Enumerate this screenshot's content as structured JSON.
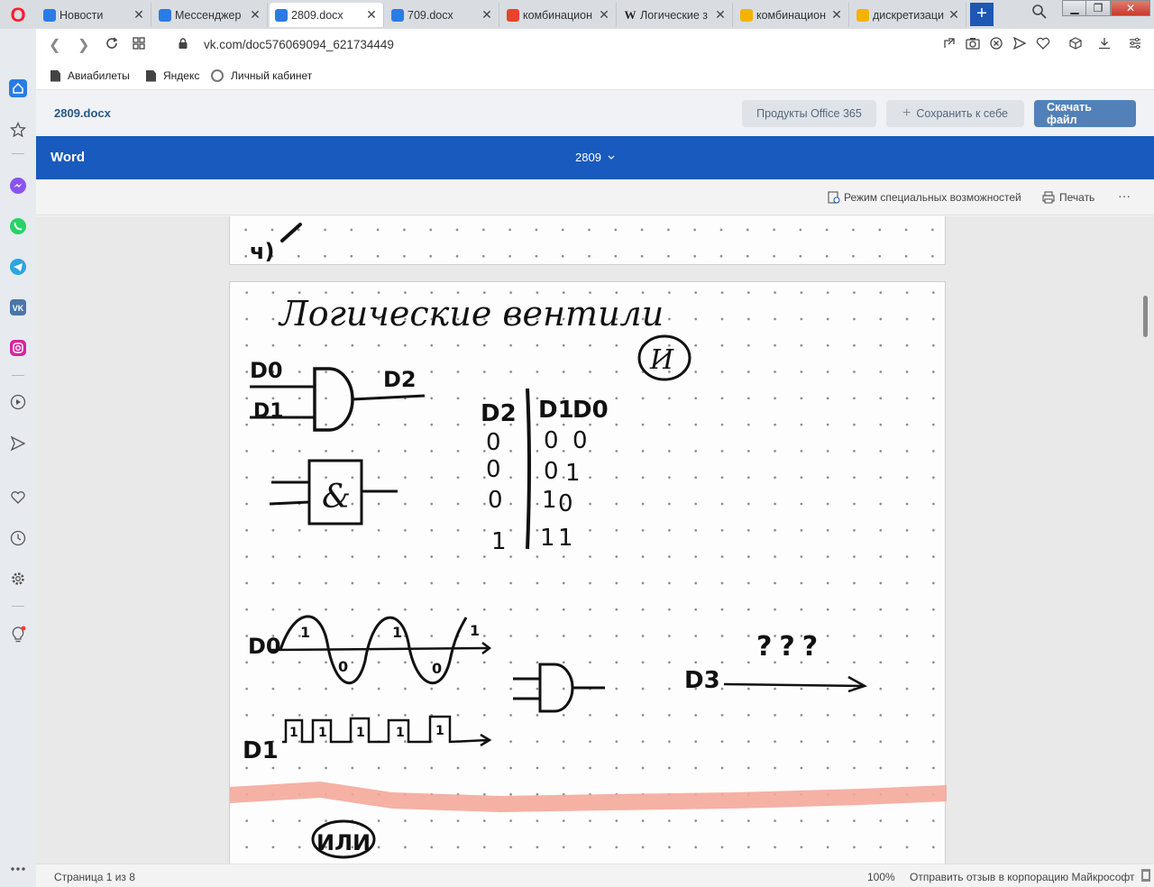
{
  "tabs": [
    {
      "title": "Новости",
      "icon": "vk-messenger-icon",
      "color": "#2a7be4"
    },
    {
      "title": "Мессенджер",
      "icon": "vk-messenger-icon",
      "color": "#2a7be4"
    },
    {
      "title": "2809.docx",
      "icon": "vk-icon",
      "color": "#2a7be4",
      "active": true
    },
    {
      "title": "709.docx",
      "icon": "vk-icon",
      "color": "#2a7be4"
    },
    {
      "title": "комбинацион",
      "icon": "yandex-icon",
      "color": "#e8432c"
    },
    {
      "title": "Логические з",
      "icon": "wikipedia-icon",
      "color": "#222222"
    },
    {
      "title": "комбинацион",
      "icon": "image-icon",
      "color": "#f2b400"
    },
    {
      "title": "дискретизаци",
      "icon": "image-icon",
      "color": "#f2b400"
    }
  ],
  "browser": {
    "logo": "O",
    "new_tab": "+",
    "url": "vk.com/doc576069094_621734449"
  },
  "bookmarks": [
    {
      "label": "Авиабилеты",
      "icon": "bookmark-icon"
    },
    {
      "label": "Яндекс",
      "icon": "bookmark-icon"
    },
    {
      "label": "Личный кабинет",
      "icon": "globe-icon"
    }
  ],
  "vk": {
    "doc_name": "2809.docx",
    "office_button": "Продукты Office 365",
    "save_button": "Сохранить к себе",
    "save_prefix": "+",
    "download_button": "Скачать файл"
  },
  "word": {
    "app_name": "Word",
    "file_name": "2809",
    "accessibility": "Режим специальных возможностей",
    "print": "Печать",
    "more": "···"
  },
  "handwriting": {
    "page1_fragment": "ч)",
    "title": "Логические вентили",
    "and_label": "И",
    "and_symbol": "&",
    "inputs": [
      "D0",
      "D1"
    ],
    "output": "D2",
    "truth_table": {
      "headers": [
        "D2",
        "D1",
        "D0"
      ],
      "rows": [
        [
          "0",
          "0",
          "0"
        ],
        [
          "0",
          "0",
          "1"
        ],
        [
          "0",
          "1",
          "0"
        ],
        [
          "1",
          "1",
          "1"
        ]
      ]
    },
    "wave_d0_labels": [
      "1",
      "0",
      "1",
      "0",
      "1"
    ],
    "wave_d1_labels": [
      "1",
      "1",
      "1",
      "1",
      "1"
    ],
    "d3_label": "D3",
    "question": "???",
    "or_label": "ИЛИ"
  },
  "status": {
    "page": "Страница 1 из 8",
    "zoom": "100%",
    "feedback": "Отправить отзыв в корпорацию Майкрософт"
  },
  "colors": {
    "word_blue": "#185abd",
    "vk_blue": "#5181b8",
    "highlighter": "#f4a89a"
  }
}
